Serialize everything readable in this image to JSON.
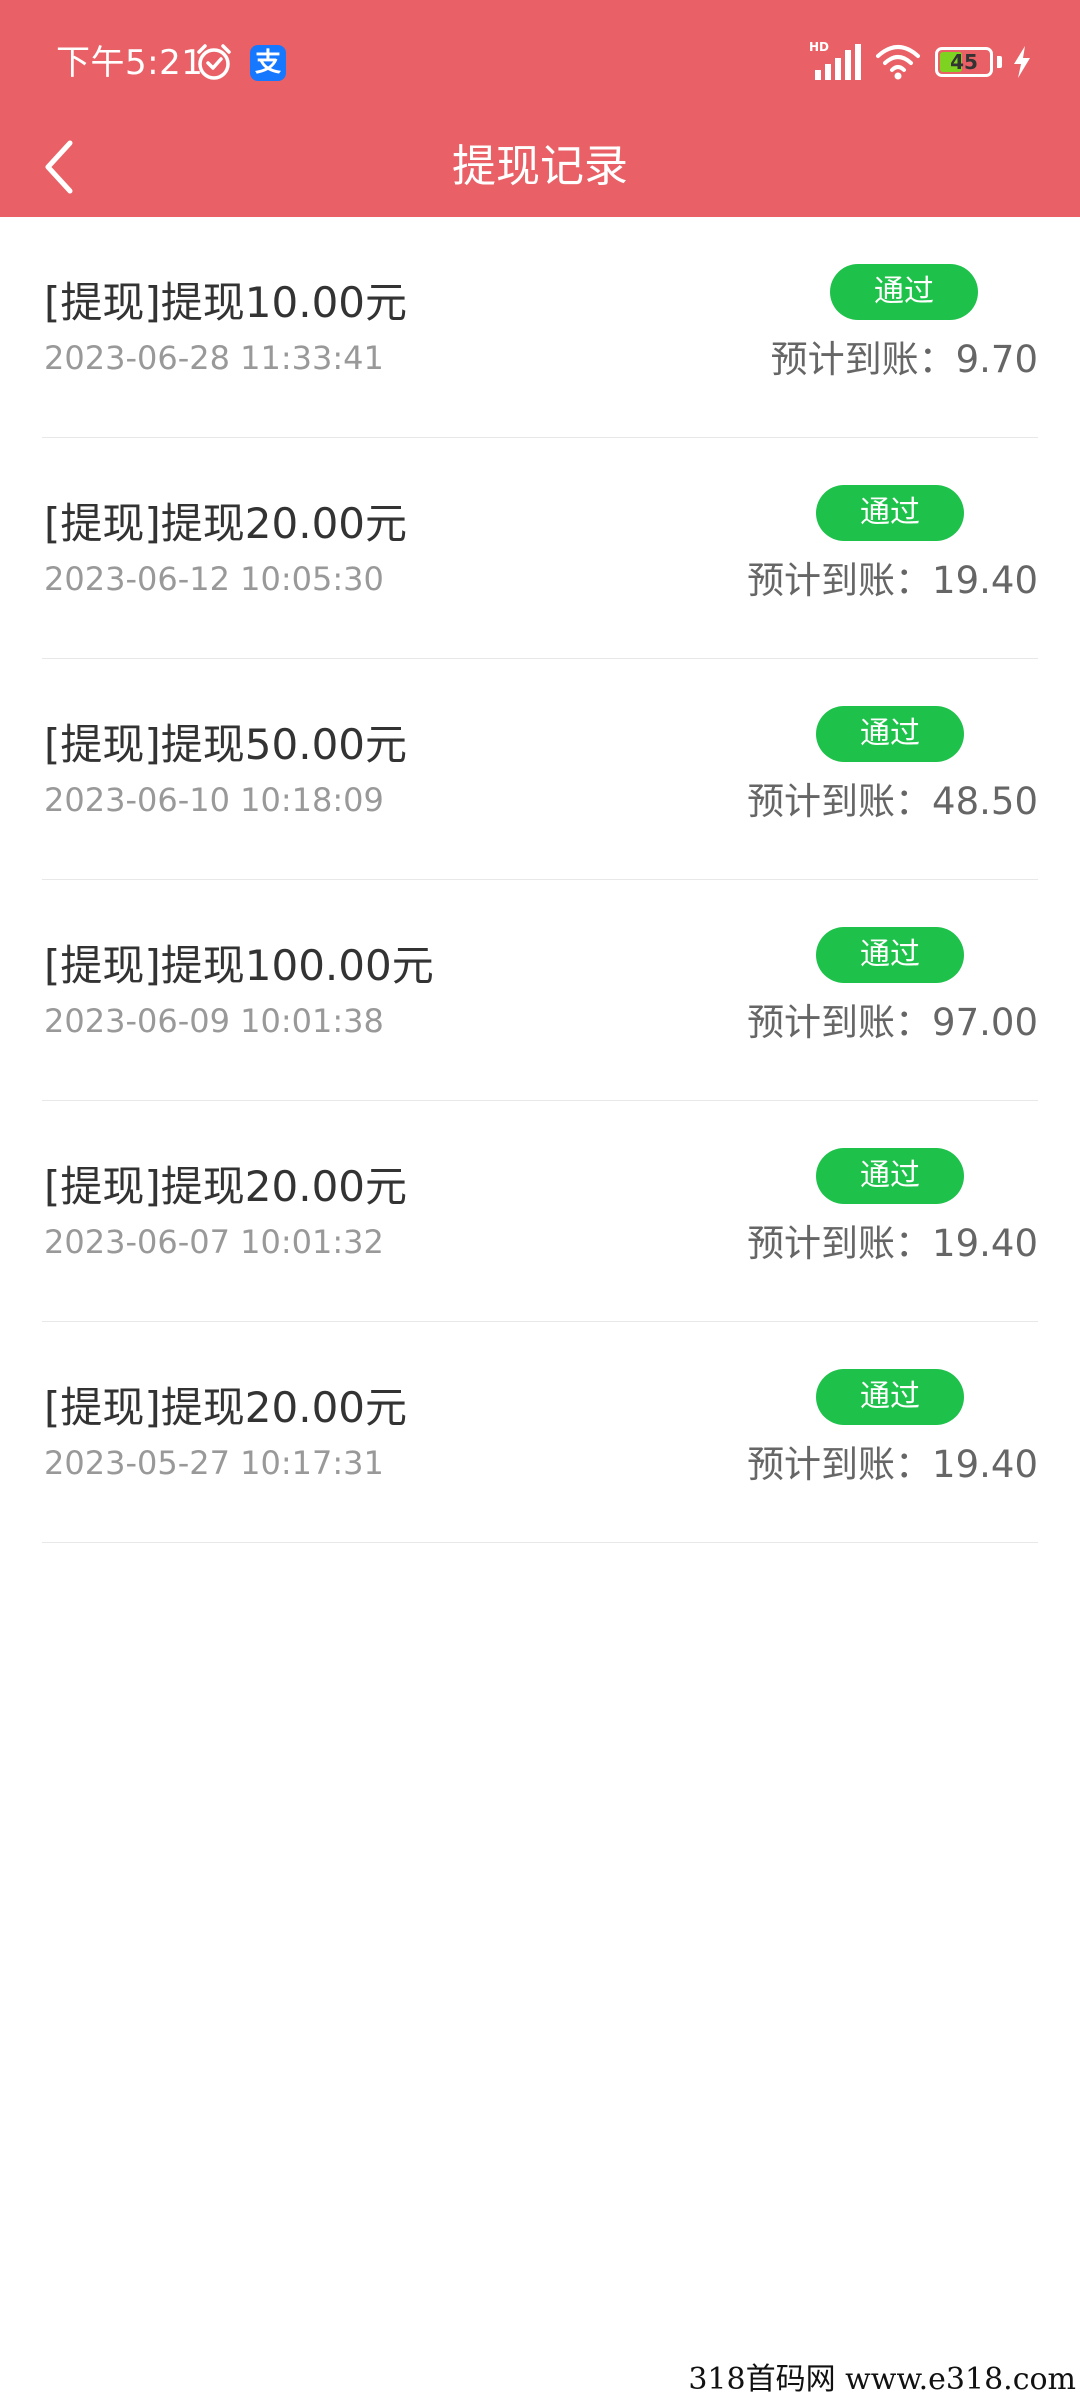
{
  "status_bar": {
    "time": "下午5:21",
    "alipay_glyph": "支",
    "network_label": "HD",
    "battery_level": "45",
    "battery_fraction": 0.45,
    "icons": [
      "alarm-icon",
      "alipay-icon",
      "signal-icon",
      "wifi-icon",
      "battery-icon",
      "charging-icon"
    ]
  },
  "header": {
    "title": "提现记录",
    "back_icon": "chevron-left-icon"
  },
  "colors": {
    "header_bg": "#e96166",
    "badge_green": "#1ec24a",
    "title_text": "#333333",
    "time_text": "#999999"
  },
  "records": [
    {
      "title": "[提现]提现10.00元",
      "time": "2023-06-28 11:33:41",
      "status": "通过",
      "expected": "预计到账：9.70"
    },
    {
      "title": "[提现]提现20.00元",
      "time": "2023-06-12 10:05:30",
      "status": "通过",
      "expected": "预计到账：19.40"
    },
    {
      "title": "[提现]提现50.00元",
      "time": "2023-06-10 10:18:09",
      "status": "通过",
      "expected": "预计到账：48.50"
    },
    {
      "title": "[提现]提现100.00元",
      "time": "2023-06-09 10:01:38",
      "status": "通过",
      "expected": "预计到账：97.00"
    },
    {
      "title": "[提现]提现20.00元",
      "time": "2023-06-07 10:01:32",
      "status": "通过",
      "expected": "预计到账：19.40"
    },
    {
      "title": "[提现]提现20.00元",
      "time": "2023-05-27 10:17:31",
      "status": "通过",
      "expected": "预计到账：19.40"
    }
  ],
  "watermark": "318首码网  www.e318.com"
}
